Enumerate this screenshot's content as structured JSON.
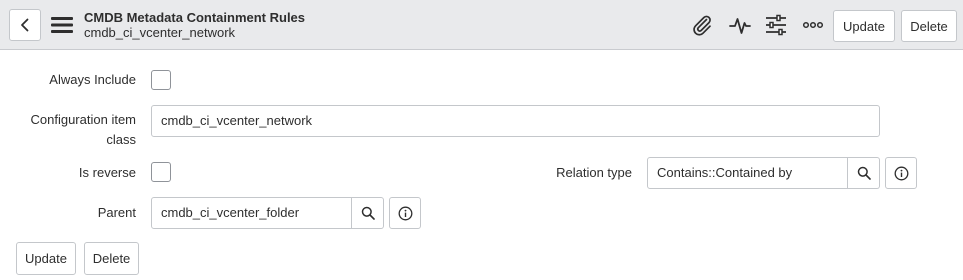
{
  "header": {
    "title": "CMDB Metadata Containment Rules",
    "subtitle": "cmdb_ci_vcenter_network",
    "update_label": "Update",
    "delete_label": "Delete",
    "icons": [
      "back-icon",
      "hamburger-menu-icon",
      "paperclip-icon",
      "activity-icon",
      "sliders-icon",
      "more-options-icon"
    ]
  },
  "form": {
    "always_include": {
      "label": "Always Include",
      "checked": false
    },
    "ci_class": {
      "label_line1": "Configuration item",
      "label_line2": "class",
      "value": "cmdb_ci_vcenter_network"
    },
    "is_reverse": {
      "label": "Is reverse",
      "checked": false
    },
    "relation_type": {
      "label": "Relation type",
      "value": "Contains::Contained by"
    },
    "parent": {
      "label": "Parent",
      "value": "cmdb_ci_vcenter_folder"
    }
  },
  "footer": {
    "update_label": "Update",
    "delete_label": "Delete"
  }
}
